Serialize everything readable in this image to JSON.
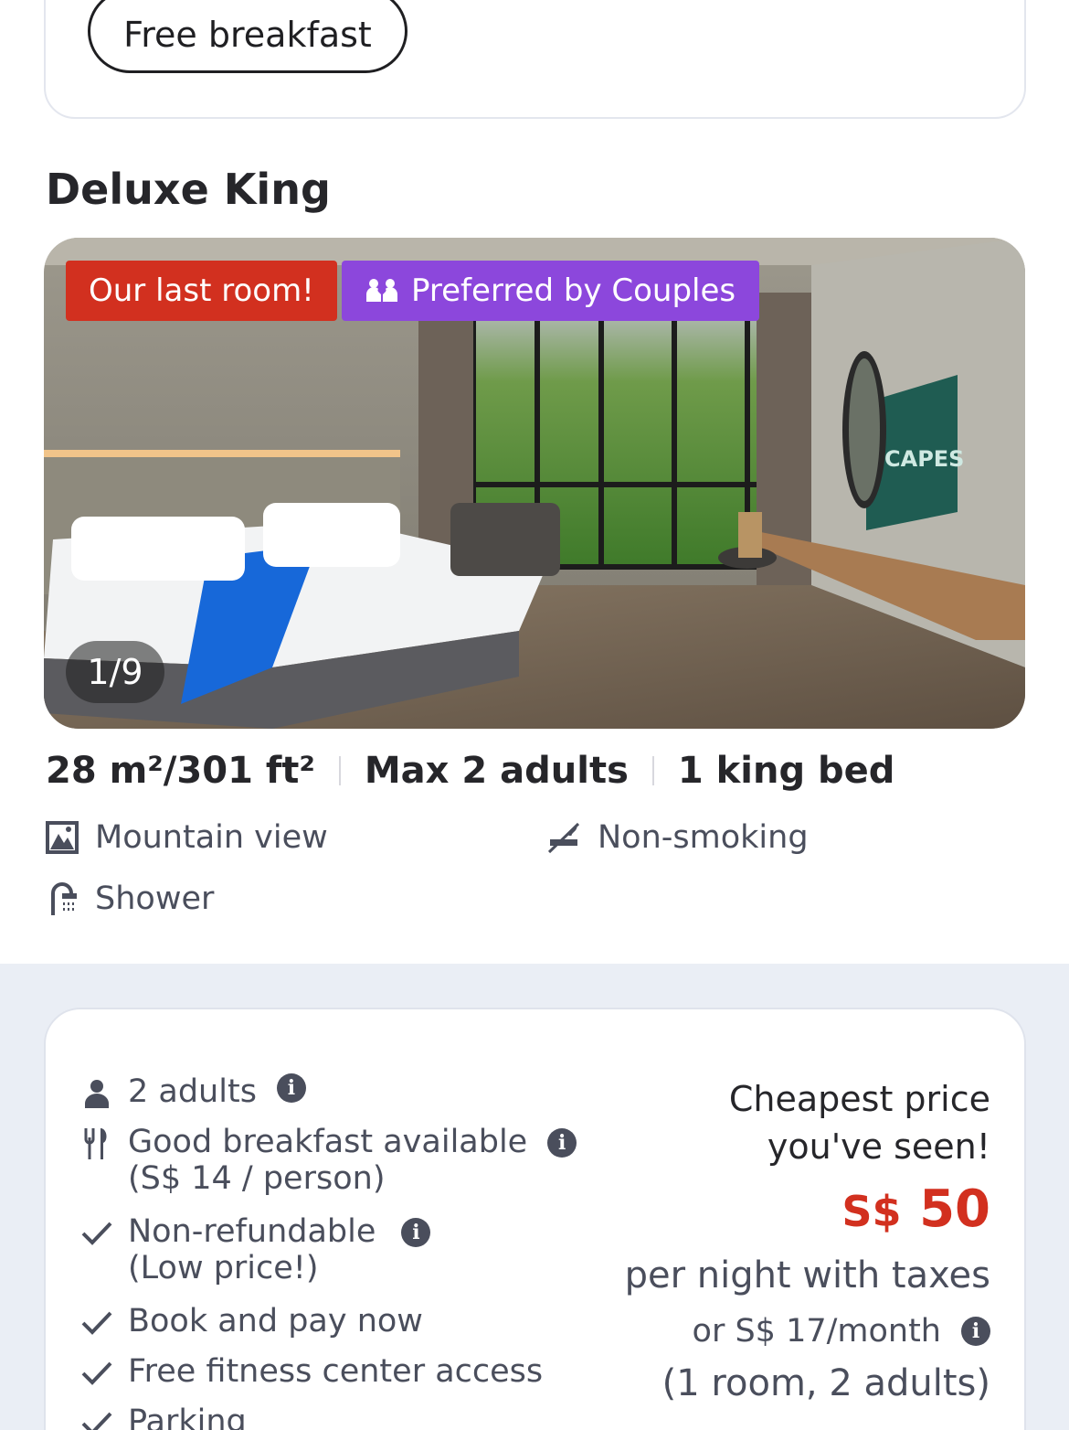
{
  "amenity_pill": "Free breakfast",
  "room": {
    "title": "Deluxe King",
    "badges": {
      "last_room": "Our last room!",
      "couples": "Preferred by Couples"
    },
    "photo_counter": "1/9",
    "photo_tv_text": "CAPES",
    "specs": {
      "size": "28 m²/301 ft²",
      "occupancy": "Max 2 adults",
      "bed": "1 king bed"
    },
    "features": {
      "view": "Mountain view",
      "smoking": "Non-smoking",
      "bath": "Shower"
    }
  },
  "rate": {
    "guests": "2 adults",
    "breakfast": "Good breakfast available",
    "breakfast_price": "(S$ 14 / person)",
    "refund": "Non-refundable",
    "refund_note": "(Low price!)",
    "payment": "Book and pay now",
    "fitness": "Free fitness center access",
    "parking": "Parking",
    "cheapest_line1": "Cheapest price",
    "cheapest_line2": "you've seen!",
    "currency": "S$",
    "amount": "50",
    "per_night": "per night with taxes",
    "monthly": "or S$ 17/month",
    "occupancy": "(1 room, 2 adults)"
  },
  "colors": {
    "accent_red": "#d2301f",
    "accent_purple": "#8c47dc",
    "band": "#eaeef5"
  }
}
